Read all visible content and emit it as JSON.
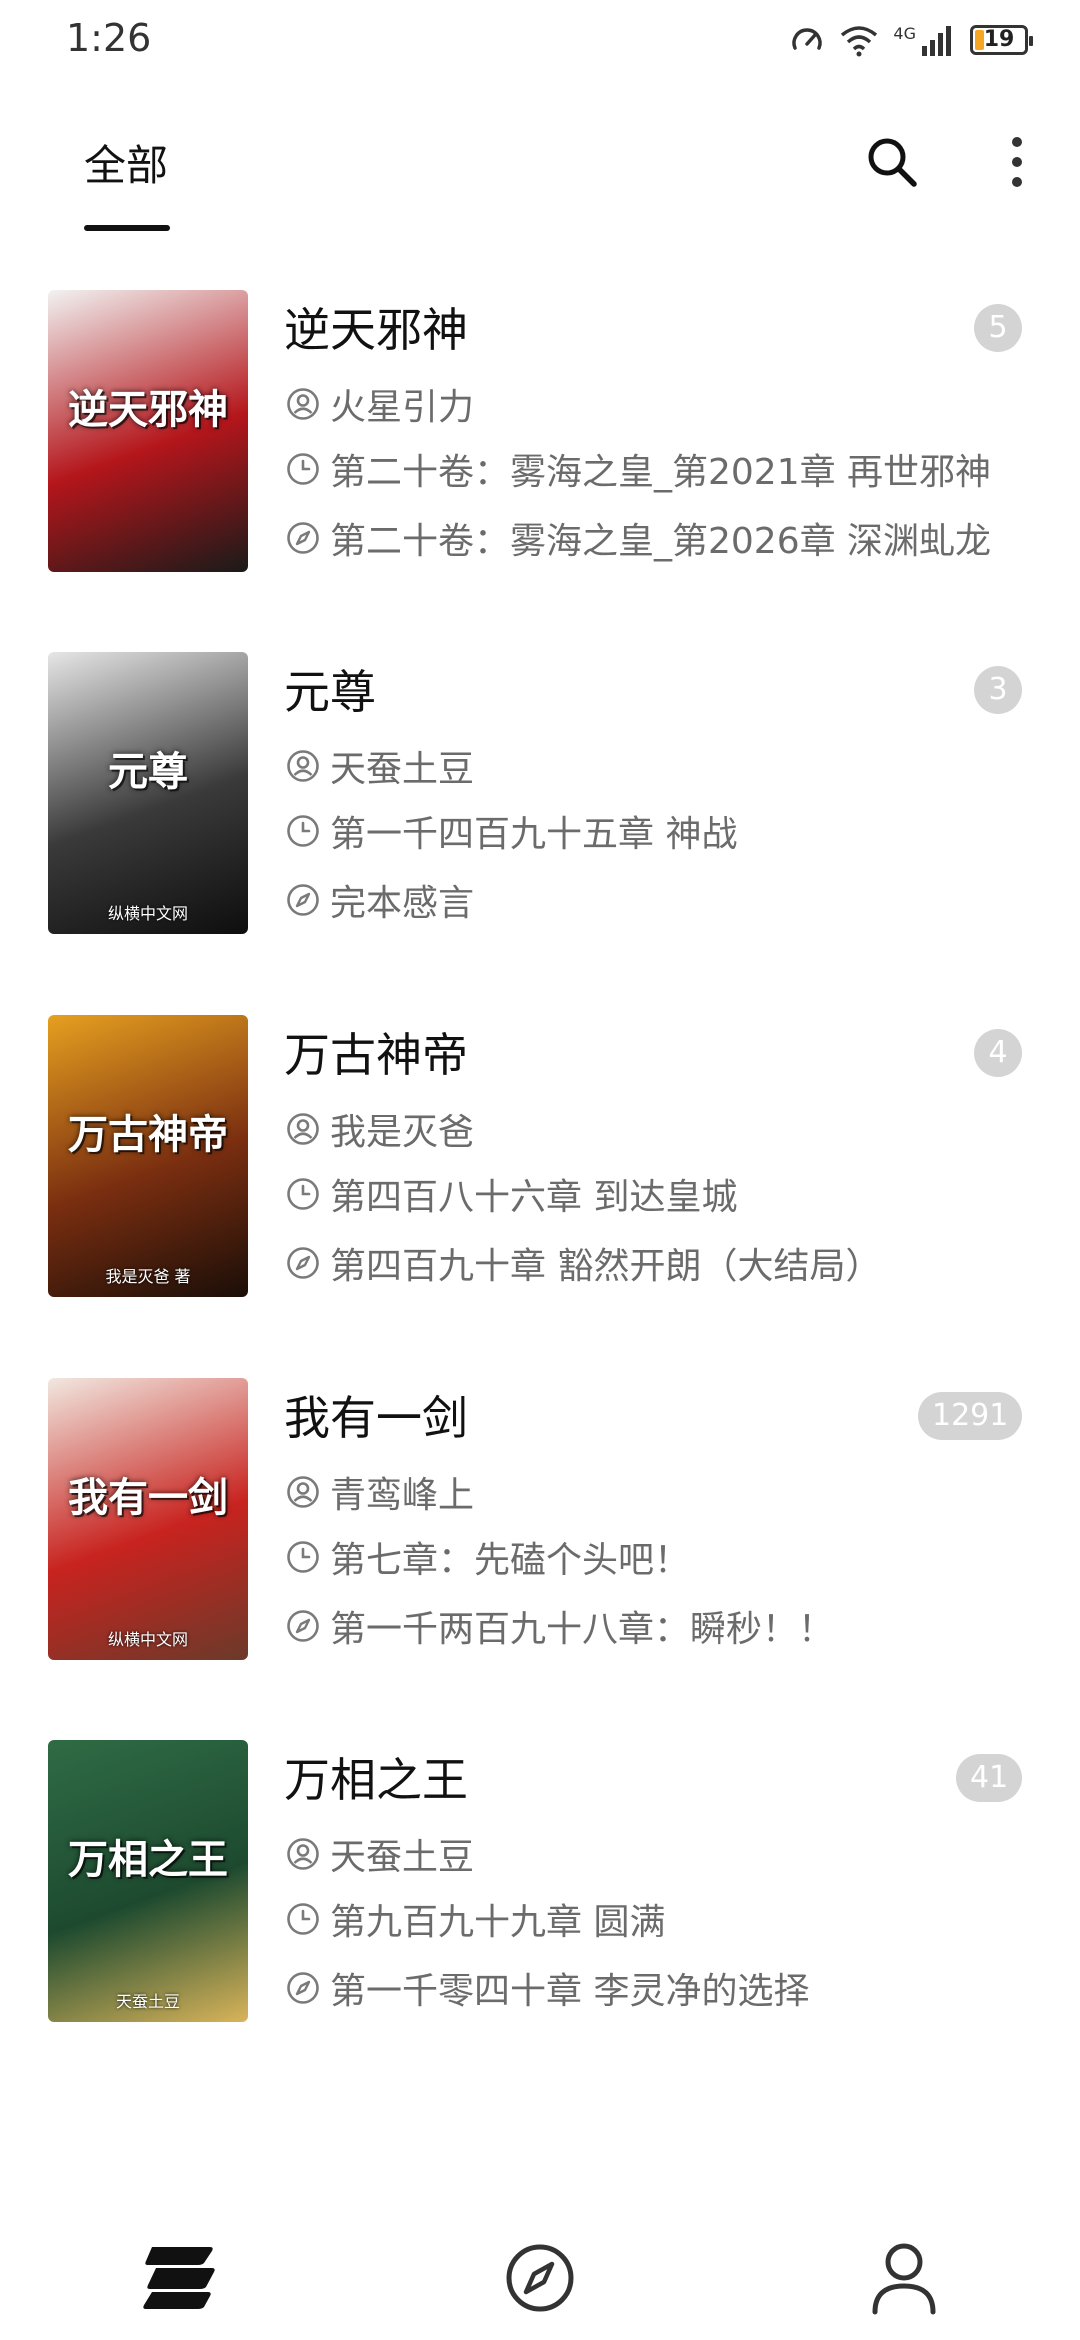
{
  "status_bar": {
    "time": "1:26",
    "network": "4G",
    "battery": "19",
    "battery_level": 0.19
  },
  "header": {
    "tab_label": "全部",
    "search_icon": "search-icon",
    "more_icon": "more-vertical-icon"
  },
  "books": [
    {
      "title": "逆天邪神",
      "badge": "5",
      "author": "火星引力",
      "read_chapter": "第二十卷：雾海之皇_第2021章 再世邪神",
      "latest_chapter": "第二十卷：雾海之皇_第2026章 深渊虬龙",
      "cover_colors": [
        "#f2f2f2",
        "#b4161b",
        "#1a1a1a"
      ]
    },
    {
      "title": "元尊",
      "badge": "3",
      "author": "天蚕土豆",
      "read_chapter": "第一千四百九十五章  神战",
      "latest_chapter": "完本感言",
      "cover_colors": [
        "#e6e6e6",
        "#3a3a3a",
        "#0e0e0e"
      ]
    },
    {
      "title": "万古神帝",
      "badge": "4",
      "author": "我是灭爸",
      "read_chapter": "第四百八十六章 到达皇城",
      "latest_chapter": "第四百九十章 豁然开朗（大结局）",
      "cover_colors": [
        "#e6a020",
        "#7a2e10",
        "#1a0e08"
      ]
    },
    {
      "title": "我有一剑",
      "badge": "1291",
      "author": "青鸾峰上",
      "read_chapter": "第七章：先磕个头吧！",
      "latest_chapter": "第一千两百九十八章：瞬秒！！",
      "cover_colors": [
        "#f1e8e0",
        "#c8231f",
        "#6b3a2a"
      ]
    },
    {
      "title": "万相之王",
      "badge": "41",
      "author": "天蚕土豆",
      "read_chapter": "第九百九十九章 圆满",
      "latest_chapter": "第一千零四十章 李灵净的选择",
      "cover_colors": [
        "#2f6b45",
        "#1d4a2f",
        "#d9b45a"
      ]
    }
  ],
  "cover_text": [
    {
      "title": "逆天邪神",
      "sub": ""
    },
    {
      "title": "元尊",
      "sub": "纵横中文网"
    },
    {
      "title": "万古神帝",
      "sub": "我是灭爸 著"
    },
    {
      "title": "我有一剑",
      "sub": "纵横中文网"
    },
    {
      "title": "万相之王",
      "sub": "天蚕土豆"
    }
  ],
  "bottom_nav": [
    {
      "name": "bookshelf-icon",
      "active": true
    },
    {
      "name": "discover-compass-icon",
      "active": false
    },
    {
      "name": "profile-person-icon",
      "active": false
    }
  ]
}
